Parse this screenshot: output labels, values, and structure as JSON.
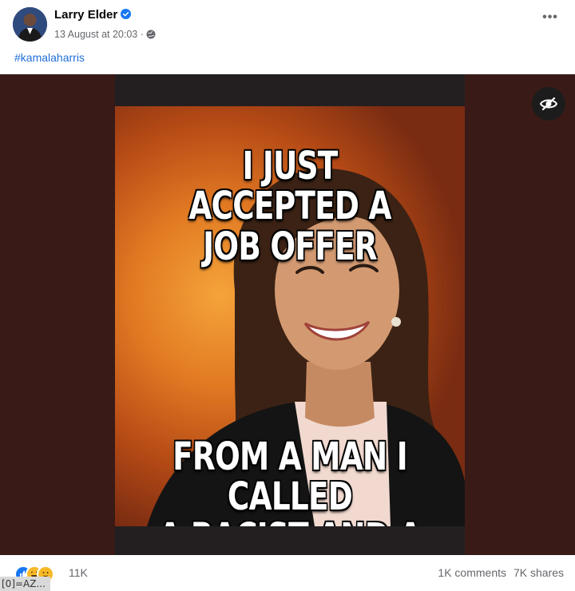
{
  "post": {
    "author": "Larry Elder",
    "timestamp": "13 August at 20:03",
    "separator": "·",
    "more_label": "•••",
    "hashtag": "#kamalaharris",
    "icons": {
      "avatar": "profile-photo",
      "verified": "verified-badge-icon",
      "audience": "globe-icon",
      "more": "more-options-icon",
      "hide": "eye-slash-icon"
    }
  },
  "meme": {
    "top_text_line1": "I JUST ACCEPTED A",
    "top_text_line2": "JOB OFFER",
    "bottom_text_line1": "FROM A MAN I CALLED",
    "bottom_text_line2": "A RACIST AND A RAPIST"
  },
  "footer": {
    "reaction_count": "11K",
    "comments": "1K comments",
    "shares": "7K shares",
    "reactions": [
      "like",
      "haha",
      "care"
    ]
  },
  "debug_tag": "[0]=AZ..."
}
